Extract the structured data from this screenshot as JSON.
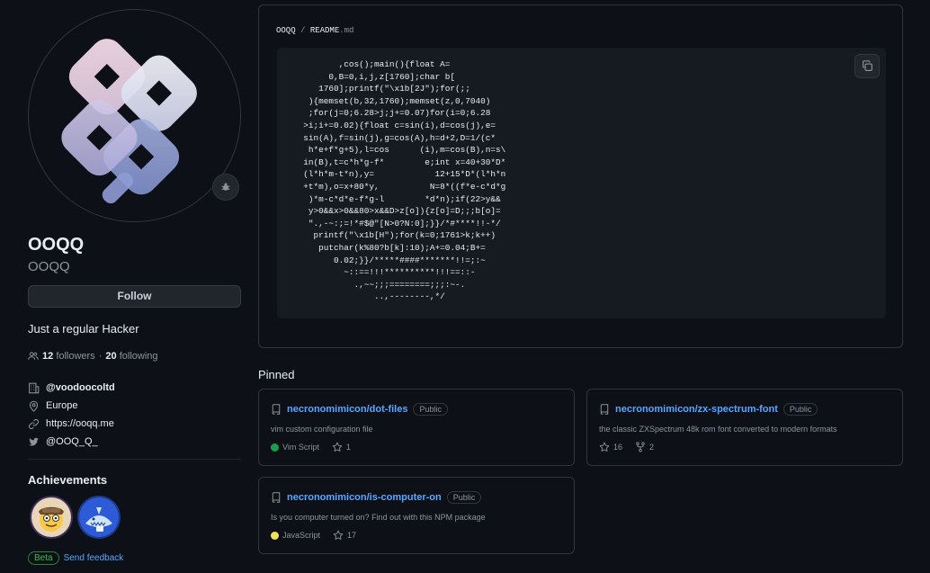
{
  "profile": {
    "name": "OOQQ",
    "login": "OOQQ",
    "follow_label": "Follow",
    "bio": "Just a regular Hacker",
    "followers_count": "12",
    "followers_label": "followers",
    "following_count": "20",
    "following_label": "following",
    "separator": "·",
    "company": "@voodoocoltd",
    "location": "Europe",
    "website": "https://ooqq.me",
    "twitter": "@OOQ_Q_"
  },
  "achievements": {
    "title": "Achievements",
    "badges": [
      {
        "name": "quickdraw-badge-icon"
      },
      {
        "name": "pull-shark-badge-icon"
      }
    ],
    "beta_label": "Beta",
    "feedback_label": "Send feedback"
  },
  "readme": {
    "path_user": "OOQQ",
    "path_sep": "/",
    "path_file": "README",
    "path_ext": ".md",
    "code": "         ,cos();main(){float A=\n       0,B=0,i,j,z[1760];char b[\n     1760];printf(\"\\x1b[2J\");for(;;\n   ){memset(b,32,1760);memset(z,0,7040)\n   ;for(j=0;6.28>j;j+=0.07)for(i=0;6.28\n  >i;i+=0.02){float c=sin(i),d=cos(j),e=\n  sin(A),f=sin(j),g=cos(A),h=d+2,D=1/(c*\n   h*e+f*g+5),l=cos      (i),m=cos(B),n=s\\\n  in(B),t=c*h*g-f*        e;int x=40+30*D*\n  (l*h*m-t*n),y=            12+15*D*(l*h*n\n  +t*m),o=x+80*y,          N=8*((f*e-c*d*g\n   )*m-c*d*e-f*g-l        *d*n);if(22>y&&\n   y>0&&x>0&&80>x&&D>z[o]){z[o]=D;;;b[o]=\n   \".,-~:;=!*#$@\"[N>0?N:0];}}/*#****!!-*/\n    printf(\"\\x1b[H\");for(k=0;1761>k;k++)\n     putchar(k%80?b[k]:10);A+=0.04;B+=\n        0.02;}}/*****####*******!!=;:~\n          ~::==!!!**********!!!==::-\n            .,~~;;;========;;;:~-.\n                ..,--------,*/",
    "copy_icon": "copy-icon"
  },
  "pinned": {
    "title": "Pinned",
    "repos": [
      {
        "name": "necronomimicon/dot-files",
        "visibility": "Public",
        "description": "vim custom configuration file",
        "language": "Vim Script",
        "language_color": "#199f4b",
        "stars": "1",
        "forks": ""
      },
      {
        "name": "necronomimicon/zx-spectrum-font",
        "visibility": "Public",
        "description": "the classic ZXSpectrum 48k rom font converted to modern formats",
        "language": "",
        "language_color": "",
        "stars": "16",
        "forks": "2"
      },
      {
        "name": "necronomimicon/is-computer-on",
        "visibility": "Public",
        "description": "Is you computer turned on? Find out with this NPM package",
        "language": "JavaScript",
        "language_color": "#f1e05a",
        "stars": "17",
        "forks": ""
      }
    ]
  },
  "colors": {
    "background": "#0d1117",
    "border": "#30363d",
    "link": "#58a6ff",
    "muted": "#8b949e"
  }
}
